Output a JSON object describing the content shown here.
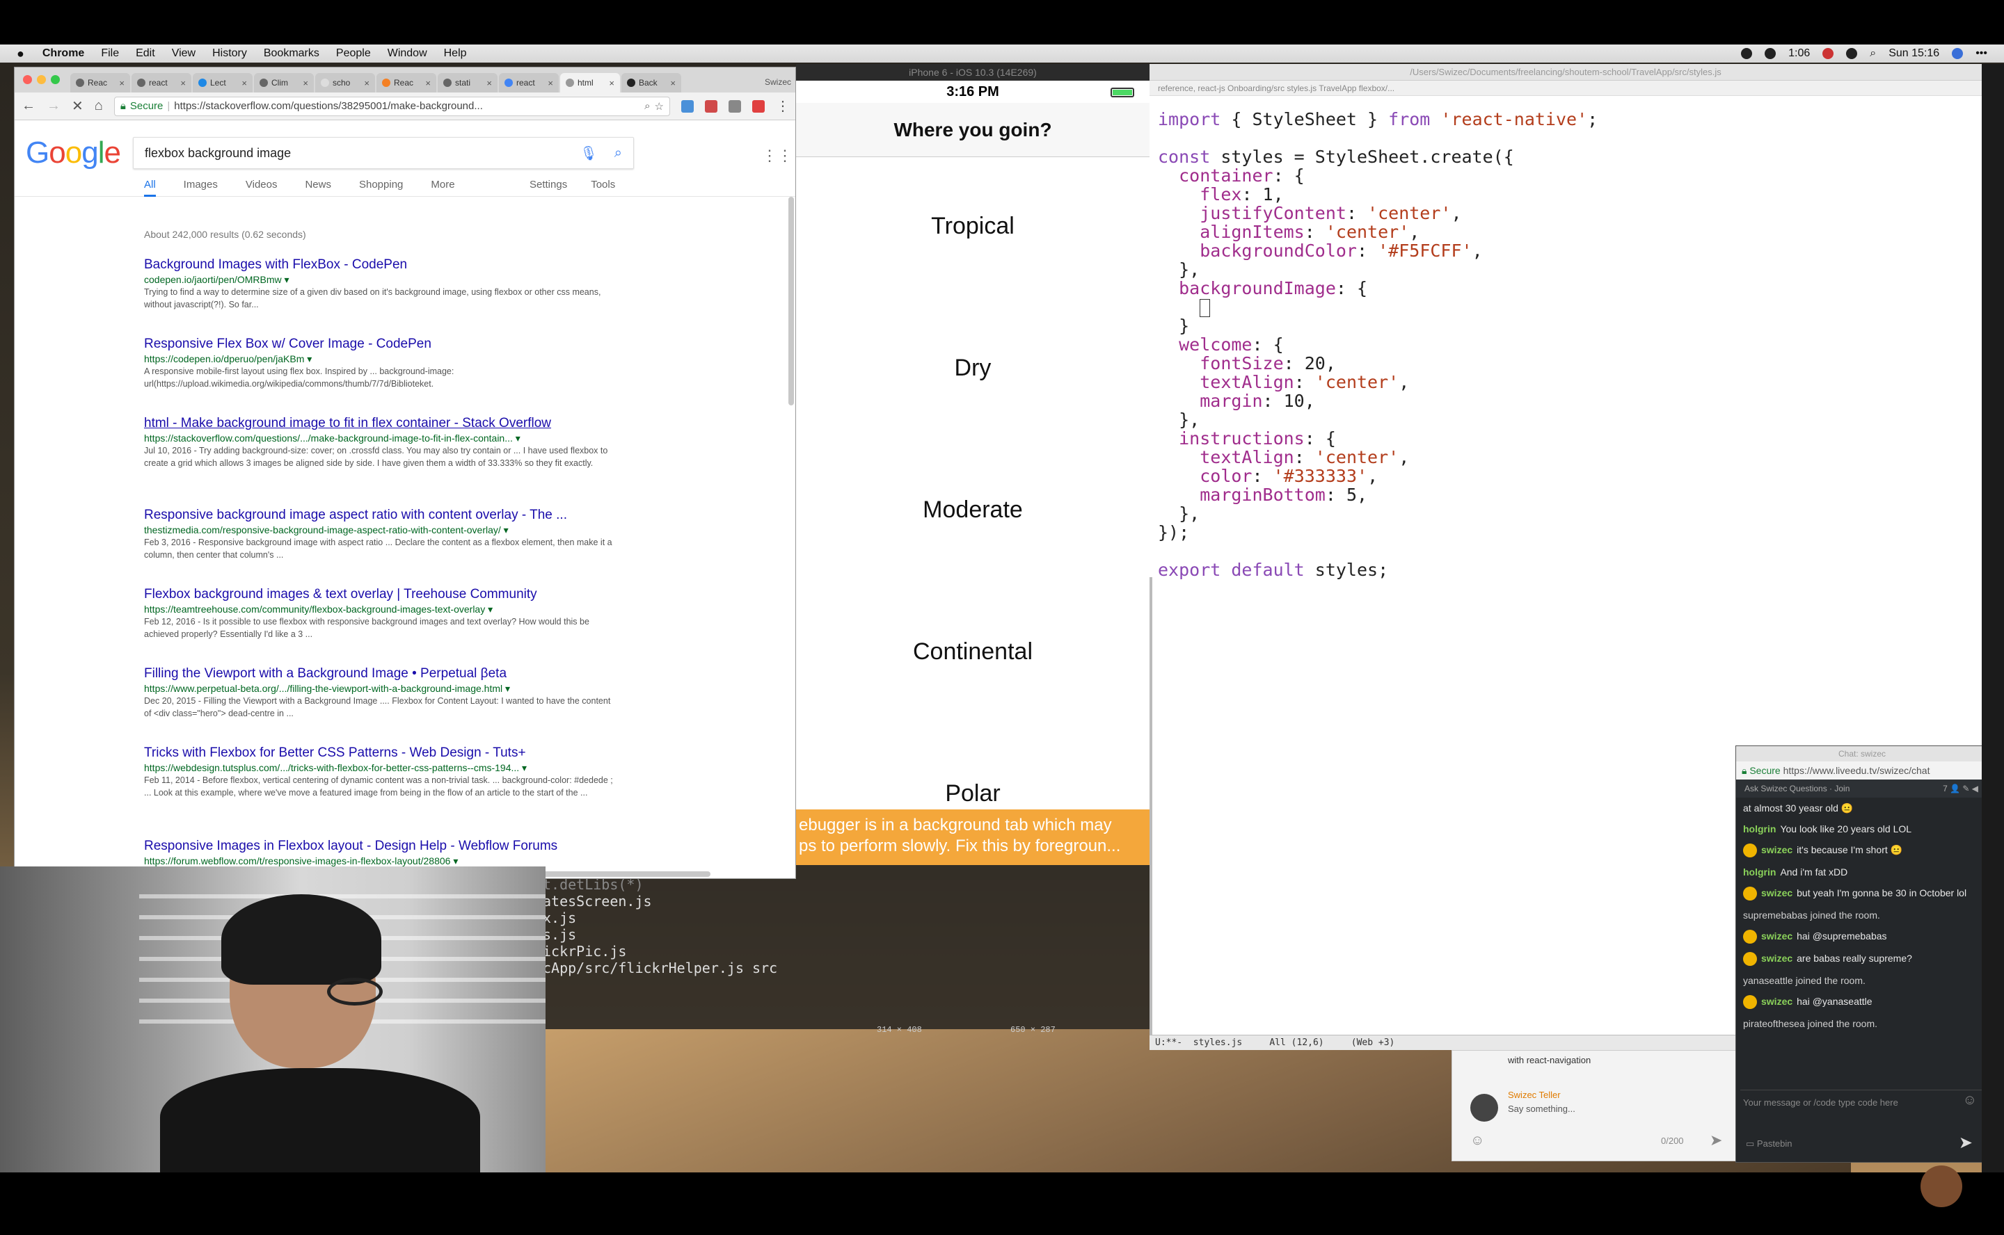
{
  "menubar": {
    "apple": "",
    "app": "Chrome",
    "items": [
      "File",
      "Edit",
      "View",
      "History",
      "Bookmarks",
      "People",
      "Window",
      "Help"
    ],
    "battery_time": "1:06",
    "clock": "Sun 15:16"
  },
  "chrome": {
    "tabs": [
      {
        "label": "Reac"
      },
      {
        "label": "react"
      },
      {
        "label": "Lect"
      },
      {
        "label": "Clim"
      },
      {
        "label": "scho"
      },
      {
        "label": "Reac"
      },
      {
        "label": "stati"
      },
      {
        "label": "react"
      },
      {
        "label": "html"
      },
      {
        "label": "Back"
      }
    ],
    "profile": "Swizec",
    "omnibox_secure": "Secure",
    "omnibox_url": "https://stackoverflow.com/questions/38295001/make-background...",
    "google": {
      "query": "flexbox background image",
      "tabs": [
        "All",
        "Images",
        "Videos",
        "News",
        "Shopping",
        "More"
      ],
      "tools": [
        "Settings",
        "Tools"
      ],
      "stats": "About 242,000 results (0.62 seconds)",
      "results": [
        {
          "title": "Background Images with FlexBox - CodePen",
          "url": "codepen.io/jaorti/pen/OMRBmw ▾",
          "snippet": "Trying to find a way to determine size of a given div based on it's background image, using flexbox or other css means, without javascript(?!). So far..."
        },
        {
          "title": "Responsive Flex Box w/ Cover Image - CodePen",
          "url": "https://codepen.io/dperuo/pen/jaKBm ▾",
          "snippet": "A responsive mobile-first layout using flex box. Inspired by ... background-image: url(https://upload.wikimedia.org/wikipedia/commons/thumb/7/7d/Biblioteket."
        },
        {
          "title": "html - Make background image to fit in flex container - Stack Overflow",
          "url": "https://stackoverflow.com/questions/.../make-background-image-to-fit-in-flex-contain... ▾",
          "snippet": "Jul 10, 2016 - Try adding background-size: cover; on .crossfd class. You may also try contain or ... I have used flexbox to create a grid which allows 3 images be aligned side by side. I have given them a width of 33.333% so they fit exactly."
        },
        {
          "title": "Responsive background image aspect ratio with content overlay - The ...",
          "url": "thestizmedia.com/responsive-background-image-aspect-ratio-with-content-overlay/ ▾",
          "snippet": "Feb 3, 2016 - Responsive background image with aspect ratio ... Declare the content as a flexbox element, then make it a column, then center that column's ..."
        },
        {
          "title": "Flexbox background images & text overlay | Treehouse Community",
          "url": "https://teamtreehouse.com/community/flexbox-background-images-text-overlay ▾",
          "snippet": "Feb 12, 2016 - Is it possible to use flexbox with responsive background images and text overlay? How would this be achieved properly? Essentially I'd like a 3 ..."
        },
        {
          "title": "Filling the Viewport with a Background Image • Perpetual βeta",
          "url": "https://www.perpetual-beta.org/.../filling-the-viewport-with-a-background-image.html ▾",
          "snippet": "Dec 20, 2015 - Filling the Viewport with a Background Image .... Flexbox for Content Layout: I wanted to have the content of <div class=\"hero\"> dead-centre in ..."
        },
        {
          "title": "Tricks with Flexbox for Better CSS Patterns - Web Design - Tuts+",
          "url": "https://webdesign.tutsplus.com/.../tricks-with-flexbox-for-better-css-patterns--cms-194... ▾",
          "snippet": "Feb 11, 2014 - Before flexbox, vertical centering of dynamic content was a non-trivial task. ... background-color: #dedede ; ... Look at this example, where we've move a featured image from being in the flow of an article to the start of the ..."
        },
        {
          "title": "Responsive Images in Flexbox layout - Design Help - Webflow Forums",
          "url": "https://forum.webflow.com/t/responsive-images-in-flexbox-layout/28806 ▾",
          "snippet": ""
        }
      ]
    }
  },
  "simulator": {
    "title": "iPhone 6 - iOS 10.3 (14E269)",
    "time": "3:16 PM",
    "nav_title": "Where you goin?",
    "options": [
      "Tropical",
      "Dry",
      "Moderate",
      "Continental",
      "Polar"
    ],
    "warning_line1": "ebugger is in a background tab which may",
    "warning_line2": "ps to perform slowly. Fix this by foregroun..."
  },
  "terminal": {
    "lines": [
      "t.detLibs(*)",
      "",
      "atesScreen.js",
      "x.js",
      "s.js",
      "ickrPic.js",
      "cApp/src/flickrHelper.js src"
    ],
    "label_a": "314 × 408",
    "label_b": "650 × 287"
  },
  "emacs": {
    "title": "/Users/Swizec/Documents/freelancing/shoutem-school/TravelApp/src/styles.js",
    "breadcrumb": "reference, react-js   Onboarding/src   styles.js   TravelApp   flexbox/...",
    "code": [
      {
        "segs": [
          [
            "kw",
            "import"
          ],
          [
            "fn",
            " { StyleSheet } "
          ],
          [
            "kw",
            "from"
          ],
          [
            "fn",
            " "
          ],
          [
            "str",
            "'react-native'"
          ],
          [
            "fn",
            ";"
          ]
        ]
      },
      {
        "segs": []
      },
      {
        "segs": [
          [
            "kw",
            "const"
          ],
          [
            "fn",
            " styles = StyleSheet.create({"
          ]
        ]
      },
      {
        "segs": [
          [
            "fn",
            "  "
          ],
          [
            "prop",
            "container"
          ],
          [
            "fn",
            ": {"
          ]
        ]
      },
      {
        "segs": [
          [
            "fn",
            "    "
          ],
          [
            "prop",
            "flex"
          ],
          [
            "fn",
            ": 1,"
          ]
        ]
      },
      {
        "segs": [
          [
            "fn",
            "    "
          ],
          [
            "prop",
            "justifyContent"
          ],
          [
            "fn",
            ": "
          ],
          [
            "str",
            "'center'"
          ],
          [
            "fn",
            ","
          ]
        ]
      },
      {
        "segs": [
          [
            "fn",
            "    "
          ],
          [
            "prop",
            "alignItems"
          ],
          [
            "fn",
            ": "
          ],
          [
            "str",
            "'center'"
          ],
          [
            "fn",
            ","
          ]
        ]
      },
      {
        "segs": [
          [
            "fn",
            "    "
          ],
          [
            "prop",
            "backgroundColor"
          ],
          [
            "fn",
            ": "
          ],
          [
            "str",
            "'#F5FCFF'"
          ],
          [
            "fn",
            ","
          ]
        ]
      },
      {
        "segs": [
          [
            "fn",
            "  },"
          ]
        ]
      },
      {
        "segs": [
          [
            "fn",
            "  "
          ],
          [
            "prop",
            "backgroundImage"
          ],
          [
            "fn",
            ": {"
          ]
        ]
      },
      {
        "segs": [
          [
            "fn",
            "    "
          ],
          [
            "cursor",
            ""
          ]
        ]
      },
      {
        "segs": [
          [
            "fn",
            "  }"
          ]
        ]
      },
      {
        "segs": [
          [
            "fn",
            "  "
          ],
          [
            "prop",
            "welcome"
          ],
          [
            "fn",
            ": {"
          ]
        ]
      },
      {
        "segs": [
          [
            "fn",
            "    "
          ],
          [
            "prop",
            "fontSize"
          ],
          [
            "fn",
            ": 20,"
          ]
        ]
      },
      {
        "segs": [
          [
            "fn",
            "    "
          ],
          [
            "prop",
            "textAlign"
          ],
          [
            "fn",
            ": "
          ],
          [
            "str",
            "'center'"
          ],
          [
            "fn",
            ","
          ]
        ]
      },
      {
        "segs": [
          [
            "fn",
            "    "
          ],
          [
            "prop",
            "margin"
          ],
          [
            "fn",
            ": 10,"
          ]
        ]
      },
      {
        "segs": [
          [
            "fn",
            "  },"
          ]
        ]
      },
      {
        "segs": [
          [
            "fn",
            "  "
          ],
          [
            "prop",
            "instructions"
          ],
          [
            "fn",
            ": {"
          ]
        ]
      },
      {
        "segs": [
          [
            "fn",
            "    "
          ],
          [
            "prop",
            "textAlign"
          ],
          [
            "fn",
            ": "
          ],
          [
            "str",
            "'center'"
          ],
          [
            "fn",
            ","
          ]
        ]
      },
      {
        "segs": [
          [
            "fn",
            "    "
          ],
          [
            "prop",
            "color"
          ],
          [
            "fn",
            ": "
          ],
          [
            "str",
            "'#333333'"
          ],
          [
            "fn",
            ","
          ]
        ]
      },
      {
        "segs": [
          [
            "fn",
            "    "
          ],
          [
            "prop",
            "marginBottom"
          ],
          [
            "fn",
            ": 5,"
          ]
        ]
      },
      {
        "segs": [
          [
            "fn",
            "  },"
          ]
        ]
      },
      {
        "segs": [
          [
            "fn",
            "});"
          ]
        ]
      },
      {
        "segs": []
      },
      {
        "segs": [
          [
            "kw",
            "export default"
          ],
          [
            "fn",
            " styles;"
          ]
        ]
      }
    ],
    "modeline": "U:**-  styles.js     All (12,6)     (Web +3)"
  },
  "oldchat": {
    "line1": "with react-navigation",
    "name": "Swizec Teller",
    "placeholder": "Say something...",
    "counter": "0/200"
  },
  "chat": {
    "title": "Chat: swizec",
    "secure": "Secure",
    "url": "https://www.liveedu.tv/swizec/chat",
    "header": "Ask Swizec Questions · Join",
    "count": "7",
    "messages": [
      {
        "user": "",
        "text": "at almost 30 yeasr old 😐",
        "sys": false,
        "avatar": false
      },
      {
        "user": "holgrin",
        "text": "You look like 20 years old LOL",
        "sys": false,
        "avatar": false
      },
      {
        "user": "swizec",
        "text": "it's because I'm short 😐",
        "sys": false,
        "avatar": true
      },
      {
        "user": "holgrin",
        "text": "And i'm fat xDD",
        "sys": false,
        "avatar": false
      },
      {
        "user": "swizec",
        "text": "but yeah I'm gonna be 30 in October lol",
        "sys": false,
        "avatar": true
      },
      {
        "user": "",
        "text": "supremebabas joined the room.",
        "sys": true,
        "avatar": false
      },
      {
        "user": "swizec",
        "text": "hai @supremebabas",
        "sys": false,
        "avatar": true
      },
      {
        "user": "swizec",
        "text": "are babas really supreme?",
        "sys": false,
        "avatar": true
      },
      {
        "user": "",
        "text": "yanaseattle joined the room.",
        "sys": true,
        "avatar": false
      },
      {
        "user": "swizec",
        "text": "hai @yanaseattle",
        "sys": false,
        "avatar": true
      },
      {
        "user": "",
        "text": "pirateofthesea joined the room.",
        "sys": true,
        "avatar": false
      }
    ],
    "input_placeholder": "Your message or /code type code here",
    "pastebin": "Pastebin"
  }
}
